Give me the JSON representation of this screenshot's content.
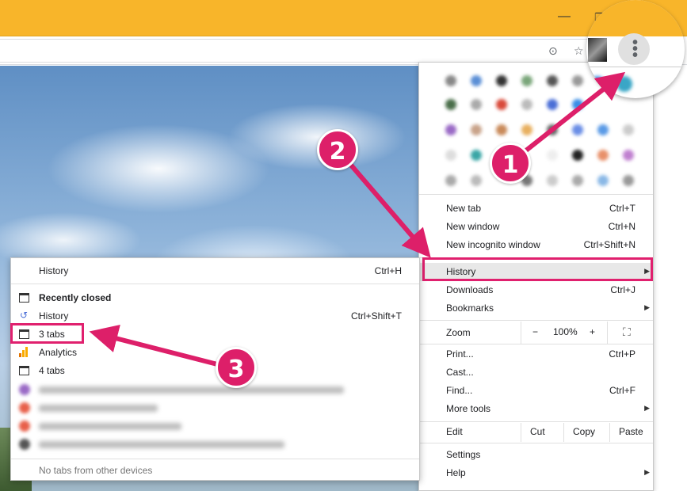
{
  "menu": {
    "new_tab": {
      "label": "New tab",
      "shortcut": "Ctrl+T"
    },
    "new_window": {
      "label": "New window",
      "shortcut": "Ctrl+N"
    },
    "new_incognito": {
      "label": "New incognito window",
      "shortcut": "Ctrl+Shift+N"
    },
    "history": {
      "label": "History"
    },
    "downloads": {
      "label": "Downloads",
      "shortcut": "Ctrl+J"
    },
    "bookmarks": {
      "label": "Bookmarks"
    },
    "zoom": {
      "label": "Zoom",
      "minus": "−",
      "level": "100%",
      "plus": "+",
      "fullscreen": "⛶"
    },
    "print": {
      "label": "Print...",
      "shortcut": "Ctrl+P"
    },
    "cast": {
      "label": "Cast..."
    },
    "find": {
      "label": "Find...",
      "shortcut": "Ctrl+F"
    },
    "more_tools": {
      "label": "More tools"
    },
    "edit": {
      "label": "Edit",
      "cut": "Cut",
      "copy": "Copy",
      "paste": "Paste"
    },
    "settings": {
      "label": "Settings"
    },
    "help": {
      "label": "Help"
    }
  },
  "history_submenu": {
    "history": {
      "label": "History",
      "shortcut": "Ctrl+H"
    },
    "recently_closed": "Recently closed",
    "history_item": {
      "label": "History",
      "shortcut": "Ctrl+Shift+T"
    },
    "three_tabs": "3 tabs",
    "analytics": "Analytics",
    "four_tabs": "4 tabs",
    "no_tabs_other_devices": "No tabs from other devices"
  },
  "callouts": {
    "one": "1",
    "two": "2",
    "three": "3"
  },
  "colors": {
    "accent": "#dd1f69",
    "titlebar": "#f8b52a"
  },
  "icons": {
    "menu": "three-dots-vertical-icon",
    "star": "star-icon",
    "location": "location-target-icon"
  }
}
